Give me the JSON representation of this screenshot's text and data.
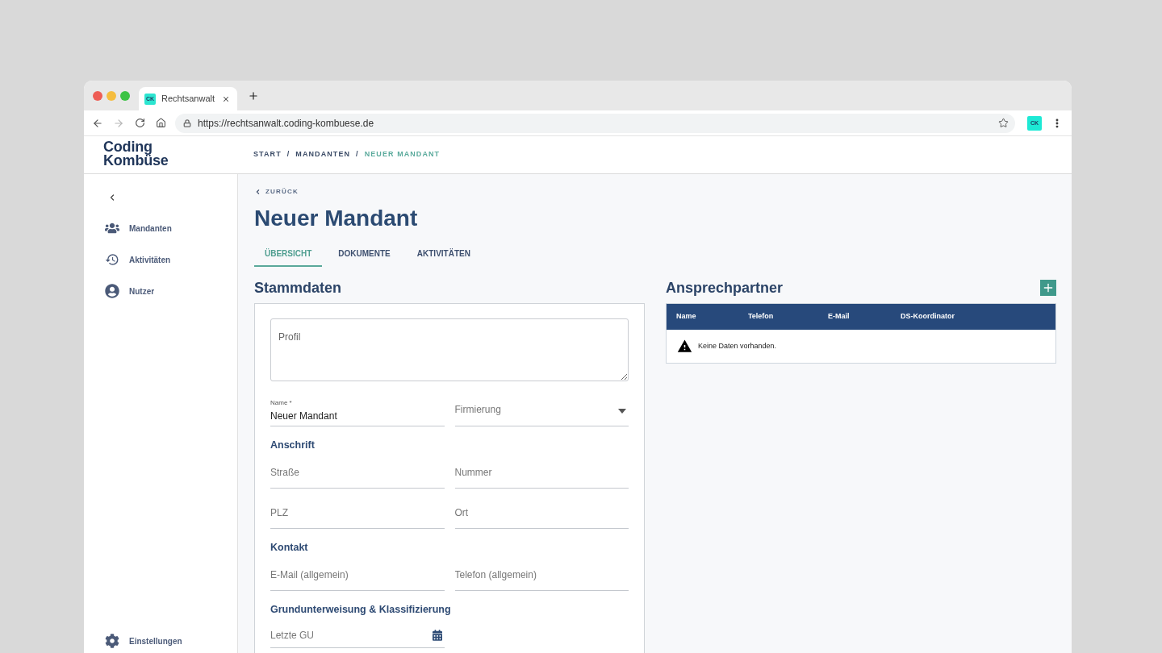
{
  "browser": {
    "tab": {
      "favicon": "CK",
      "title": "Rechtsanwalt"
    },
    "navigation": {
      "back_disabled": false,
      "forward_disabled": true
    },
    "url": "https://rechtsanwalt.coding-kombuese.de",
    "extension": "CK"
  },
  "header": {
    "logo": [
      "Coding",
      "Kombüse"
    ],
    "breadcrumb": [
      {
        "label": "START",
        "current": false,
        "separator": "/"
      },
      {
        "label": "MANDANTEN",
        "current": false,
        "separator": "/"
      },
      {
        "label": "NEUER MANDANT",
        "current": true
      }
    ]
  },
  "sidebar": {
    "items": [
      {
        "label": "Mandanten",
        "selected": false
      },
      {
        "label": "Aktivitäten",
        "selected": false
      },
      {
        "label": "Nutzer",
        "selected": false
      }
    ],
    "footer_items": [
      {
        "label": "Einstellungen",
        "selected": false
      }
    ]
  },
  "page": {
    "back": "ZURÜCK",
    "title": "Neuer Mandant",
    "tabs": [
      {
        "label": "ÜBERSICHT",
        "selected": true
      },
      {
        "label": "DOKUMENTE",
        "selected": false
      },
      {
        "label": "AKTIVITÄTEN",
        "selected": false
      }
    ]
  },
  "stammdaten": {
    "title": "Stammdaten",
    "profile": {
      "placeholder": "Profil"
    },
    "fields": [
      {
        "kind": "text",
        "label": "Name *",
        "value": "Neuer Mandant"
      },
      {
        "kind": "select",
        "placeholder": "Firmierung"
      }
    ],
    "sections": [
      {
        "title": "Anschrift",
        "fields": [
          {
            "kind": "text",
            "placeholder": "Straße"
          },
          {
            "kind": "text",
            "placeholder": "Nummer"
          },
          {
            "kind": "text",
            "placeholder": "PLZ"
          },
          {
            "kind": "text",
            "placeholder": "Ort"
          }
        ]
      },
      {
        "title": "Kontakt",
        "fields": [
          {
            "kind": "text",
            "placeholder": "E-Mail (allgemein)"
          },
          {
            "kind": "text",
            "placeholder": "Telefon (allgemein)"
          }
        ]
      },
      {
        "title": "Grundunterweisung & Klassifizierung",
        "fields": [
          {
            "kind": "date",
            "placeholder": "Letzte GU"
          }
        ]
      }
    ]
  },
  "ansprechpartner": {
    "title": "Ansprechpartner",
    "table": {
      "columns": [
        "Name",
        "Telefon",
        "E-Mail",
        "DS-Koordinator"
      ],
      "empty_message": "Keine Daten vorhanden."
    }
  }
}
